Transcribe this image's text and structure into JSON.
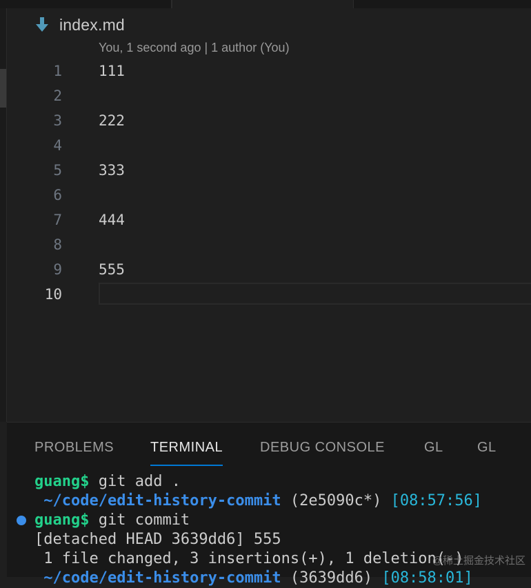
{
  "editor": {
    "file_name": "index.md",
    "file_icon": "markdown-download-icon",
    "codelens": "You, 1 second ago | 1 author (You)",
    "active_line": 10,
    "lines": [
      {
        "num": "1",
        "text": "111"
      },
      {
        "num": "2",
        "text": ""
      },
      {
        "num": "3",
        "text": "222"
      },
      {
        "num": "4",
        "text": ""
      },
      {
        "num": "5",
        "text": "333"
      },
      {
        "num": "6",
        "text": ""
      },
      {
        "num": "7",
        "text": "444"
      },
      {
        "num": "8",
        "text": ""
      },
      {
        "num": "9",
        "text": "555"
      },
      {
        "num": "10",
        "text": ""
      }
    ]
  },
  "panel": {
    "tabs": [
      {
        "label": "PROBLEMS",
        "active": false
      },
      {
        "label": "TERMINAL",
        "active": true
      },
      {
        "label": "DEBUG CONSOLE",
        "active": false
      },
      {
        "label": "GL",
        "active": false
      },
      {
        "label": "GL",
        "active": false
      }
    ],
    "active_tab_color": "#0078d4"
  },
  "terminal": {
    "lines": [
      {
        "prompt": "guang$",
        "cmd": " git add ."
      },
      {
        "path": " ~/code/edit-history-commit",
        "branch": " (2e5090c*)",
        "time": " [08:57:56]"
      },
      {
        "prompt": "guang$",
        "cmd": " git commit",
        "dot": true
      },
      {
        "text": "[detached HEAD 3639dd6] 555"
      },
      {
        "text": " 1 file changed, 3 insertions(+), 1 deletion(-)"
      },
      {
        "path": " ~/code/edit-history-commit",
        "branch": " (3639dd6)",
        "time": " [08:58:01]"
      }
    ],
    "colors": {
      "prompt": "#23d18b",
      "path": "#3b8eea",
      "time": "#29b8db",
      "dot": "#3b8eea"
    }
  },
  "watermark": "@稀土掘金技术社区"
}
